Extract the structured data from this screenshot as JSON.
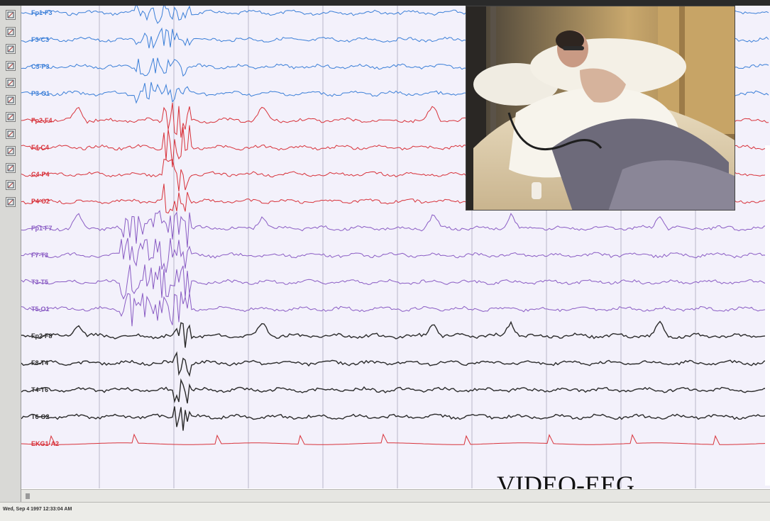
{
  "window": {
    "top_bar_color": "#2a2a2a"
  },
  "toolbar": {
    "tools": [
      {
        "icon": "pointer-icon"
      },
      {
        "icon": "cursor-icon"
      },
      {
        "icon": "montage-icon"
      },
      {
        "icon": "zoom-icon"
      },
      {
        "icon": "filter-icon"
      },
      {
        "icon": "page-icon"
      },
      {
        "icon": "marker-icon"
      },
      {
        "icon": "annotation-icon"
      },
      {
        "icon": "pen-icon"
      },
      {
        "icon": "measure-icon"
      },
      {
        "icon": "arrow-icon"
      },
      {
        "icon": "flag-icon"
      }
    ]
  },
  "eeg": {
    "background": "#f3f1fb",
    "gridline_color": "#b9b6c9",
    "groups": [
      {
        "name": "group-1",
        "color": "#3b7fd8",
        "channels": [
          "Fp1-F3",
          "F3-C3",
          "C3-P3",
          "P3-O1"
        ]
      },
      {
        "name": "group-2",
        "color": "#d8323a",
        "channels": [
          "Fp2-F4",
          "F4-C4",
          "C4-P4",
          "P4-O2"
        ]
      },
      {
        "name": "group-3",
        "color": "#8a5cc4",
        "channels": [
          "Fp1-F7",
          "F7-T3",
          "T3-T5",
          "T5-O1"
        ]
      },
      {
        "name": "group-4",
        "color": "#2b2b2b",
        "channels": [
          "Fp2-F8",
          "F8-T4",
          "T4-T6",
          "T6-O2"
        ]
      },
      {
        "name": "ecg",
        "color": "#d8323a",
        "channels": [
          "EKG1-A2"
        ]
      }
    ]
  },
  "video": {
    "title": "VIDEO-EEG"
  },
  "status": {
    "timestamp": "Wed, Sep 4 1997 12:33:04 AM"
  }
}
